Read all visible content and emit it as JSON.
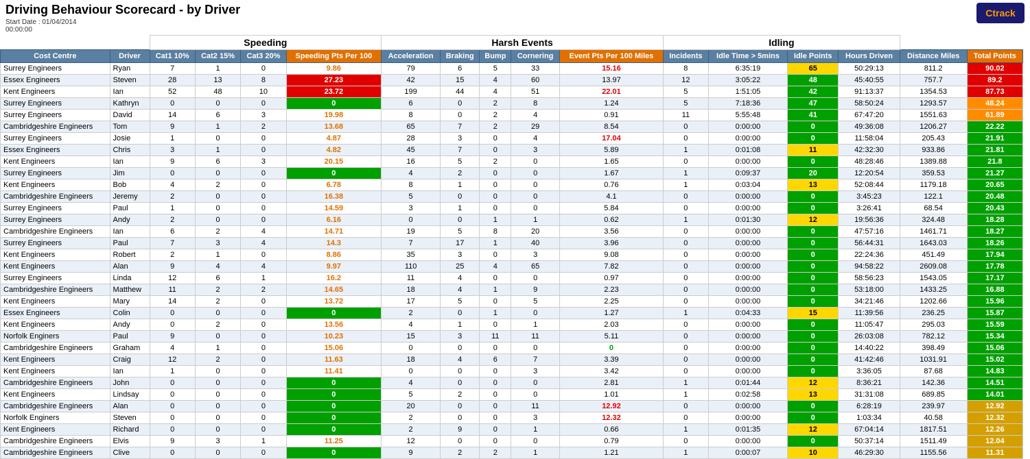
{
  "title": "Driving Behaviour Scorecard - by Driver",
  "startDate": "Start Date : 01/04/2014",
  "startTime": "00:00:00",
  "logo": {
    "prefix": "C",
    "suffix": "track"
  },
  "sections": {
    "speeding": "Speeding",
    "harshEvents": "Harsh Events",
    "idling": "Idling"
  },
  "columns": {
    "costCentre": "Cost Centre",
    "driver": "Driver",
    "cat1": "Cat1 10%",
    "cat2": "Cat2 15%",
    "cat3": "Cat3 20%",
    "speedingPts": "Speeding Pts Per 100",
    "acceleration": "Acceleration",
    "braking": "Braking",
    "bump": "Bump",
    "cornering": "Cornering",
    "eventPts": "Event Pts Per 100 Miles",
    "incidents": "Incidents",
    "idleTime": "Idle Time > 5mins",
    "idlePoints": "Idle Points",
    "hoursDriven": "Hours Driven",
    "distanceMiles": "Distance Miles",
    "totalPoints": "Total Points"
  },
  "rows": [
    {
      "costCentre": "Surrey Engineers",
      "driver": "Ryan",
      "cat1": 7,
      "cat2": 1,
      "cat3": 0,
      "speedingPts": 9.86,
      "speedingColor": "orange",
      "acceleration": 79,
      "braking": 6,
      "bump": 5,
      "cornering": 33,
      "eventPts": 15.16,
      "eventColor": "red",
      "incidents": 8,
      "idleTime": "6:35:19",
      "idlePoints": 65,
      "idleColor": "yellow",
      "hoursDriven": "50:29:13",
      "distanceMiles": 811.2,
      "totalPoints": 90.02,
      "totalColor": "red"
    },
    {
      "costCentre": "Essex Engineers",
      "driver": "Steven",
      "cat1": 28,
      "cat2": 13,
      "cat3": 8,
      "speedingPts": 27.23,
      "speedingColor": "red",
      "acceleration": 42,
      "braking": 15,
      "bump": 4,
      "cornering": 60,
      "eventPts": 13.97,
      "eventColor": "orange",
      "incidents": 12,
      "idleTime": "3:05:22",
      "idlePoints": 48,
      "idleColor": "green",
      "hoursDriven": "45:40:55",
      "distanceMiles": 757.7,
      "totalPoints": 89.2,
      "totalColor": "red"
    },
    {
      "costCentre": "Kent Engineers",
      "driver": "Ian",
      "cat1": 52,
      "cat2": 48,
      "cat3": 10,
      "speedingPts": 23.72,
      "speedingColor": "red",
      "acceleration": 199,
      "braking": 44,
      "bump": 4,
      "cornering": 51,
      "eventPts": 22.01,
      "eventColor": "red",
      "incidents": 5,
      "idleTime": "1:51:05",
      "idlePoints": 42,
      "idleColor": "green",
      "hoursDriven": "91:13:37",
      "distanceMiles": 1354.53,
      "totalPoints": 87.73,
      "totalColor": "red"
    },
    {
      "costCentre": "Surrey Engineers",
      "driver": "Kathryn",
      "cat1": 0,
      "cat2": 0,
      "cat3": 0,
      "speedingPts": 0,
      "speedingColor": "green",
      "acceleration": 6,
      "braking": 0,
      "bump": 2,
      "cornering": 8,
      "eventPts": 1.24,
      "eventColor": "normal",
      "incidents": 5,
      "idleTime": "7:18:36",
      "idlePoints": 47,
      "idleColor": "green",
      "hoursDriven": "58:50:24",
      "distanceMiles": 1293.57,
      "totalPoints": 48.24,
      "totalColor": "orange"
    },
    {
      "costCentre": "Surrey Engineers",
      "driver": "David",
      "cat1": 14,
      "cat2": 6,
      "cat3": 3,
      "speedingPts": 19.98,
      "speedingColor": "orange",
      "acceleration": 8,
      "braking": 0,
      "bump": 2,
      "cornering": 4,
      "eventPts": 0.91,
      "eventColor": "normal",
      "incidents": 11,
      "idleTime": "5:55:48",
      "idlePoints": 41,
      "idleColor": "green",
      "hoursDriven": "67:47:20",
      "distanceMiles": 1551.63,
      "totalPoints": 61.89,
      "totalColor": "orange"
    },
    {
      "costCentre": "Cambridgeshire Engineers",
      "driver": "Tom",
      "cat1": 9,
      "cat2": 1,
      "cat3": 2,
      "speedingPts": 13.68,
      "speedingColor": "orange",
      "acceleration": 65,
      "braking": 7,
      "bump": 2,
      "cornering": 29,
      "eventPts": 8.54,
      "eventColor": "normal",
      "incidents": 0,
      "idleTime": "0:00:00",
      "idlePoints": 0,
      "idleColor": "green",
      "hoursDriven": "49:36:08",
      "distanceMiles": 1206.27,
      "totalPoints": 22.22,
      "totalColor": "green"
    },
    {
      "costCentre": "Surrey Engineers",
      "driver": "Josie",
      "cat1": 1,
      "cat2": 0,
      "cat3": 0,
      "speedingPts": 4.87,
      "speedingColor": "orange",
      "acceleration": 28,
      "braking": 3,
      "bump": 0,
      "cornering": 4,
      "eventPts": 17.04,
      "eventColor": "red",
      "incidents": 0,
      "idleTime": "0:00:00",
      "idlePoints": 0,
      "idleColor": "green",
      "hoursDriven": "11:58:04",
      "distanceMiles": 205.43,
      "totalPoints": 21.91,
      "totalColor": "green"
    },
    {
      "costCentre": "Essex Engineers",
      "driver": "Chris",
      "cat1": 3,
      "cat2": 1,
      "cat3": 0,
      "speedingPts": 4.82,
      "speedingColor": "orange",
      "acceleration": 45,
      "braking": 7,
      "bump": 0,
      "cornering": 3,
      "eventPts": 5.89,
      "eventColor": "normal",
      "incidents": 1,
      "idleTime": "0:01:08",
      "idlePoints": 11,
      "idleColor": "yellow",
      "hoursDriven": "42:32:30",
      "distanceMiles": 933.86,
      "totalPoints": 21.81,
      "totalColor": "green"
    },
    {
      "costCentre": "Kent Engineers",
      "driver": "Ian",
      "cat1": 9,
      "cat2": 6,
      "cat3": 3,
      "speedingPts": 20.15,
      "speedingColor": "orange",
      "acceleration": 16,
      "braking": 5,
      "bump": 2,
      "cornering": 0,
      "eventPts": 1.65,
      "eventColor": "normal",
      "incidents": 0,
      "idleTime": "0:00:00",
      "idlePoints": 0,
      "idleColor": "green",
      "hoursDriven": "48:28:46",
      "distanceMiles": 1389.88,
      "totalPoints": 21.8,
      "totalColor": "green"
    },
    {
      "costCentre": "Surrey Engineers",
      "driver": "Jim",
      "cat1": 0,
      "cat2": 0,
      "cat3": 0,
      "speedingPts": 0,
      "speedingColor": "green",
      "acceleration": 4,
      "braking": 2,
      "bump": 0,
      "cornering": 0,
      "eventPts": 1.67,
      "eventColor": "normal",
      "incidents": 1,
      "idleTime": "0:09:37",
      "idlePoints": 20,
      "idleColor": "green",
      "hoursDriven": "12:20:54",
      "distanceMiles": 359.53,
      "totalPoints": 21.27,
      "totalColor": "green"
    },
    {
      "costCentre": "Kent Engineers",
      "driver": "Bob",
      "cat1": 4,
      "cat2": 2,
      "cat3": 0,
      "speedingPts": 6.78,
      "speedingColor": "orange",
      "acceleration": 8,
      "braking": 1,
      "bump": 0,
      "cornering": 0,
      "eventPts": 0.76,
      "eventColor": "normal",
      "incidents": 1,
      "idleTime": "0:03:04",
      "idlePoints": 13,
      "idleColor": "yellow",
      "hoursDriven": "52:08:44",
      "distanceMiles": 1179.18,
      "totalPoints": 20.65,
      "totalColor": "green"
    },
    {
      "costCentre": "Cambridgeshire Engineers",
      "driver": "Jeremy",
      "cat1": 2,
      "cat2": 0,
      "cat3": 0,
      "speedingPts": 16.38,
      "speedingColor": "orange",
      "acceleration": 5,
      "braking": 0,
      "bump": 0,
      "cornering": 0,
      "eventPts": 4.1,
      "eventColor": "normal",
      "incidents": 0,
      "idleTime": "0:00:00",
      "idlePoints": 0,
      "idleColor": "green",
      "hoursDriven": "3:45:23",
      "distanceMiles": 122.1,
      "totalPoints": 20.48,
      "totalColor": "green"
    },
    {
      "costCentre": "Surrey Engineers",
      "driver": "Paul",
      "cat1": 1,
      "cat2": 0,
      "cat3": 0,
      "speedingPts": 14.59,
      "speedingColor": "orange",
      "acceleration": 3,
      "braking": 1,
      "bump": 0,
      "cornering": 0,
      "eventPts": 5.84,
      "eventColor": "normal",
      "incidents": 0,
      "idleTime": "0:00:00",
      "idlePoints": 0,
      "idleColor": "green",
      "hoursDriven": "3:26:41",
      "distanceMiles": 68.54,
      "totalPoints": 20.43,
      "totalColor": "green"
    },
    {
      "costCentre": "Surrey Engineers",
      "driver": "Andy",
      "cat1": 2,
      "cat2": 0,
      "cat3": 0,
      "speedingPts": 6.16,
      "speedingColor": "orange",
      "acceleration": 0,
      "braking": 0,
      "bump": 1,
      "cornering": 1,
      "eventPts": 0.62,
      "eventColor": "normal",
      "incidents": 1,
      "idleTime": "0:01:30",
      "idlePoints": 12,
      "idleColor": "yellow",
      "hoursDriven": "19:56:36",
      "distanceMiles": 324.48,
      "totalPoints": 18.28,
      "totalColor": "green"
    },
    {
      "costCentre": "Cambridgeshire Engineers",
      "driver": "Ian",
      "cat1": 6,
      "cat2": 2,
      "cat3": 4,
      "speedingPts": 14.71,
      "speedingColor": "orange",
      "acceleration": 19,
      "braking": 5,
      "bump": 8,
      "cornering": 20,
      "eventPts": 3.56,
      "eventColor": "normal",
      "incidents": 0,
      "idleTime": "0:00:00",
      "idlePoints": 0,
      "idleColor": "green",
      "hoursDriven": "47:57:16",
      "distanceMiles": 1461.71,
      "totalPoints": 18.27,
      "totalColor": "green"
    },
    {
      "costCentre": "Surrey Engineers",
      "driver": "Paul",
      "cat1": 7,
      "cat2": 3,
      "cat3": 4,
      "speedingPts": 14.3,
      "speedingColor": "orange",
      "acceleration": 7,
      "braking": 17,
      "bump": 1,
      "cornering": 40,
      "eventPts": 3.96,
      "eventColor": "normal",
      "incidents": 0,
      "idleTime": "0:00:00",
      "idlePoints": 0,
      "idleColor": "green",
      "hoursDriven": "56:44:31",
      "distanceMiles": 1643.03,
      "totalPoints": 18.26,
      "totalColor": "green"
    },
    {
      "costCentre": "Kent Engineers",
      "driver": "Robert",
      "cat1": 2,
      "cat2": 1,
      "cat3": 0,
      "speedingPts": 8.86,
      "speedingColor": "orange",
      "acceleration": 35,
      "braking": 3,
      "bump": 0,
      "cornering": 3,
      "eventPts": 9.08,
      "eventColor": "normal",
      "incidents": 0,
      "idleTime": "0:00:00",
      "idlePoints": 0,
      "idleColor": "green",
      "hoursDriven": "22:24:36",
      "distanceMiles": 451.49,
      "totalPoints": 17.94,
      "totalColor": "green"
    },
    {
      "costCentre": "Kent Engineers",
      "driver": "Alan",
      "cat1": 9,
      "cat2": 4,
      "cat3": 4,
      "speedingPts": 9.97,
      "speedingColor": "orange",
      "acceleration": 110,
      "braking": 25,
      "bump": 4,
      "cornering": 65,
      "eventPts": 7.82,
      "eventColor": "normal",
      "incidents": 0,
      "idleTime": "0:00:00",
      "idlePoints": 0,
      "idleColor": "green",
      "hoursDriven": "94:58:22",
      "distanceMiles": 2609.08,
      "totalPoints": 17.78,
      "totalColor": "green"
    },
    {
      "costCentre": "Surrey Engineers",
      "driver": "Linda",
      "cat1": 12,
      "cat2": 6,
      "cat3": 1,
      "speedingPts": 16.2,
      "speedingColor": "orange",
      "acceleration": 11,
      "braking": 4,
      "bump": 0,
      "cornering": 0,
      "eventPts": 0.97,
      "eventColor": "normal",
      "incidents": 0,
      "idleTime": "0:00:00",
      "idlePoints": 0,
      "idleColor": "green",
      "hoursDriven": "58:56:23",
      "distanceMiles": 1543.05,
      "totalPoints": 17.17,
      "totalColor": "green"
    },
    {
      "costCentre": "Cambridgeshire Engineers",
      "driver": "Matthew",
      "cat1": 11,
      "cat2": 2,
      "cat3": 2,
      "speedingPts": 14.65,
      "speedingColor": "orange",
      "acceleration": 18,
      "braking": 4,
      "bump": 1,
      "cornering": 9,
      "eventPts": 2.23,
      "eventColor": "normal",
      "incidents": 0,
      "idleTime": "0:00:00",
      "idlePoints": 0,
      "idleColor": "green",
      "hoursDriven": "53:18:00",
      "distanceMiles": 1433.25,
      "totalPoints": 16.88,
      "totalColor": "green"
    },
    {
      "costCentre": "Kent Engineers",
      "driver": "Mary",
      "cat1": 14,
      "cat2": 2,
      "cat3": 0,
      "speedingPts": 13.72,
      "speedingColor": "orange",
      "acceleration": 17,
      "braking": 5,
      "bump": 0,
      "cornering": 5,
      "eventPts": 2.25,
      "eventColor": "normal",
      "incidents": 0,
      "idleTime": "0:00:00",
      "idlePoints": 0,
      "idleColor": "green",
      "hoursDriven": "34:21:46",
      "distanceMiles": 1202.66,
      "totalPoints": 15.96,
      "totalColor": "green"
    },
    {
      "costCentre": "Essex Engineers",
      "driver": "Colin",
      "cat1": 0,
      "cat2": 0,
      "cat3": 0,
      "speedingPts": 0,
      "speedingColor": "green",
      "acceleration": 2,
      "braking": 0,
      "bump": 1,
      "cornering": 0,
      "eventPts": 1.27,
      "eventColor": "normal",
      "incidents": 1,
      "idleTime": "0:04:33",
      "idlePoints": 15,
      "idleColor": "yellow",
      "hoursDriven": "11:39:56",
      "distanceMiles": 236.25,
      "totalPoints": 15.87,
      "totalColor": "green"
    },
    {
      "costCentre": "Kent Engineers",
      "driver": "Andy",
      "cat1": 0,
      "cat2": 2,
      "cat3": 0,
      "speedingPts": 13.56,
      "speedingColor": "orange",
      "acceleration": 4,
      "braking": 1,
      "bump": 0,
      "cornering": 1,
      "eventPts": 2.03,
      "eventColor": "normal",
      "incidents": 0,
      "idleTime": "0:00:00",
      "idlePoints": 0,
      "idleColor": "green",
      "hoursDriven": "11:05:47",
      "distanceMiles": 295.03,
      "totalPoints": 15.59,
      "totalColor": "green"
    },
    {
      "costCentre": "Norfolk Enginers",
      "driver": "Paul",
      "cat1": 9,
      "cat2": 0,
      "cat3": 0,
      "speedingPts": 10.23,
      "speedingColor": "orange",
      "acceleration": 15,
      "braking": 3,
      "bump": 11,
      "cornering": 11,
      "eventPts": 5.11,
      "eventColor": "normal",
      "incidents": 0,
      "idleTime": "0:00:00",
      "idlePoints": 0,
      "idleColor": "green",
      "hoursDriven": "26:03:08",
      "distanceMiles": 782.12,
      "totalPoints": 15.34,
      "totalColor": "green"
    },
    {
      "costCentre": "Cambridgeshire Engineers",
      "driver": "Graham",
      "cat1": 4,
      "cat2": 1,
      "cat3": 0,
      "speedingPts": 15.06,
      "speedingColor": "orange",
      "acceleration": 0,
      "braking": 0,
      "bump": 0,
      "cornering": 0,
      "eventPts": 0,
      "eventColor": "green",
      "incidents": 0,
      "idleTime": "0:00:00",
      "idlePoints": 0,
      "idleColor": "green",
      "hoursDriven": "14:40:22",
      "distanceMiles": 398.49,
      "totalPoints": 15.06,
      "totalColor": "green"
    },
    {
      "costCentre": "Kent Engineers",
      "driver": "Craig",
      "cat1": 12,
      "cat2": 2,
      "cat3": 0,
      "speedingPts": 11.63,
      "speedingColor": "orange",
      "acceleration": 18,
      "braking": 4,
      "bump": 6,
      "cornering": 7,
      "eventPts": 3.39,
      "eventColor": "normal",
      "incidents": 0,
      "idleTime": "0:00:00",
      "idlePoints": 0,
      "idleColor": "green",
      "hoursDriven": "41:42:46",
      "distanceMiles": 1031.91,
      "totalPoints": 15.02,
      "totalColor": "green"
    },
    {
      "costCentre": "Kent Engineers",
      "driver": "Ian",
      "cat1": 1,
      "cat2": 0,
      "cat3": 0,
      "speedingPts": 11.41,
      "speedingColor": "orange",
      "acceleration": 0,
      "braking": 0,
      "bump": 0,
      "cornering": 3,
      "eventPts": 3.42,
      "eventColor": "normal",
      "incidents": 0,
      "idleTime": "0:00:00",
      "idlePoints": 0,
      "idleColor": "green",
      "hoursDriven": "3:36:05",
      "distanceMiles": 87.68,
      "totalPoints": 14.83,
      "totalColor": "green"
    },
    {
      "costCentre": "Cambridgeshire Engineers",
      "driver": "John",
      "cat1": 0,
      "cat2": 0,
      "cat3": 0,
      "speedingPts": 0,
      "speedingColor": "green",
      "acceleration": 4,
      "braking": 0,
      "bump": 0,
      "cornering": 0,
      "eventPts": 2.81,
      "eventColor": "normal",
      "incidents": 1,
      "idleTime": "0:01:44",
      "idlePoints": 12,
      "idleColor": "yellow",
      "hoursDriven": "8:36:21",
      "distanceMiles": 142.36,
      "totalPoints": 14.51,
      "totalColor": "green"
    },
    {
      "costCentre": "Kent Engineers",
      "driver": "Lindsay",
      "cat1": 0,
      "cat2": 0,
      "cat3": 0,
      "speedingPts": 0,
      "speedingColor": "green",
      "acceleration": 5,
      "braking": 2,
      "bump": 0,
      "cornering": 0,
      "eventPts": 1.01,
      "eventColor": "normal",
      "incidents": 1,
      "idleTime": "0:02:58",
      "idlePoints": 13,
      "idleColor": "yellow",
      "hoursDriven": "31:31:08",
      "distanceMiles": 689.85,
      "totalPoints": 14.01,
      "totalColor": "green"
    },
    {
      "costCentre": "Cambridgeshire Engineers",
      "driver": "Alan",
      "cat1": 0,
      "cat2": 0,
      "cat3": 0,
      "speedingPts": 0,
      "speedingColor": "green",
      "acceleration": 20,
      "braking": 0,
      "bump": 0,
      "cornering": 11,
      "eventPts": 12.92,
      "eventColor": "red",
      "incidents": 0,
      "idleTime": "0:00:00",
      "idlePoints": 0,
      "idleColor": "green",
      "hoursDriven": "6:28:19",
      "distanceMiles": 239.97,
      "totalPoints": 12.92,
      "totalColor": "yellow"
    },
    {
      "costCentre": "Norfolk Enginers",
      "driver": "Steven",
      "cat1": 0,
      "cat2": 0,
      "cat3": 0,
      "speedingPts": 0,
      "speedingColor": "green",
      "acceleration": 2,
      "braking": 0,
      "bump": 0,
      "cornering": 3,
      "eventPts": 12.32,
      "eventColor": "red",
      "incidents": 0,
      "idleTime": "0:00:00",
      "idlePoints": 0,
      "idleColor": "green",
      "hoursDriven": "1:03:34",
      "distanceMiles": 40.58,
      "totalPoints": 12.32,
      "totalColor": "yellow"
    },
    {
      "costCentre": "Kent Engineers",
      "driver": "Richard",
      "cat1": 0,
      "cat2": 0,
      "cat3": 0,
      "speedingPts": 0,
      "speedingColor": "green",
      "acceleration": 2,
      "braking": 9,
      "bump": 0,
      "cornering": 1,
      "eventPts": 0.66,
      "eventColor": "normal",
      "incidents": 1,
      "idleTime": "0:01:35",
      "idlePoints": 12,
      "idleColor": "yellow",
      "hoursDriven": "67:04:14",
      "distanceMiles": 1817.51,
      "totalPoints": 12.26,
      "totalColor": "yellow"
    },
    {
      "costCentre": "Cambridgeshire Engineers",
      "driver": "Elvis",
      "cat1": 9,
      "cat2": 3,
      "cat3": 1,
      "speedingPts": 11.25,
      "speedingColor": "orange",
      "acceleration": 12,
      "braking": 0,
      "bump": 0,
      "cornering": 0,
      "eventPts": 0.79,
      "eventColor": "normal",
      "incidents": 0,
      "idleTime": "0:00:00",
      "idlePoints": 0,
      "idleColor": "green",
      "hoursDriven": "50:37:14",
      "distanceMiles": 1511.49,
      "totalPoints": 12.04,
      "totalColor": "yellow"
    },
    {
      "costCentre": "Cambridgeshire Engineers",
      "driver": "Clive",
      "cat1": 0,
      "cat2": 0,
      "cat3": 0,
      "speedingPts": 0,
      "speedingColor": "green",
      "acceleration": 9,
      "braking": 2,
      "bump": 2,
      "cornering": 1,
      "eventPts": 1.21,
      "eventColor": "normal",
      "incidents": 1,
      "idleTime": "0:00:07",
      "idlePoints": 10,
      "idleColor": "yellow",
      "hoursDriven": "46:29:30",
      "distanceMiles": 1155.56,
      "totalPoints": 11.31,
      "totalColor": "yellow"
    }
  ]
}
